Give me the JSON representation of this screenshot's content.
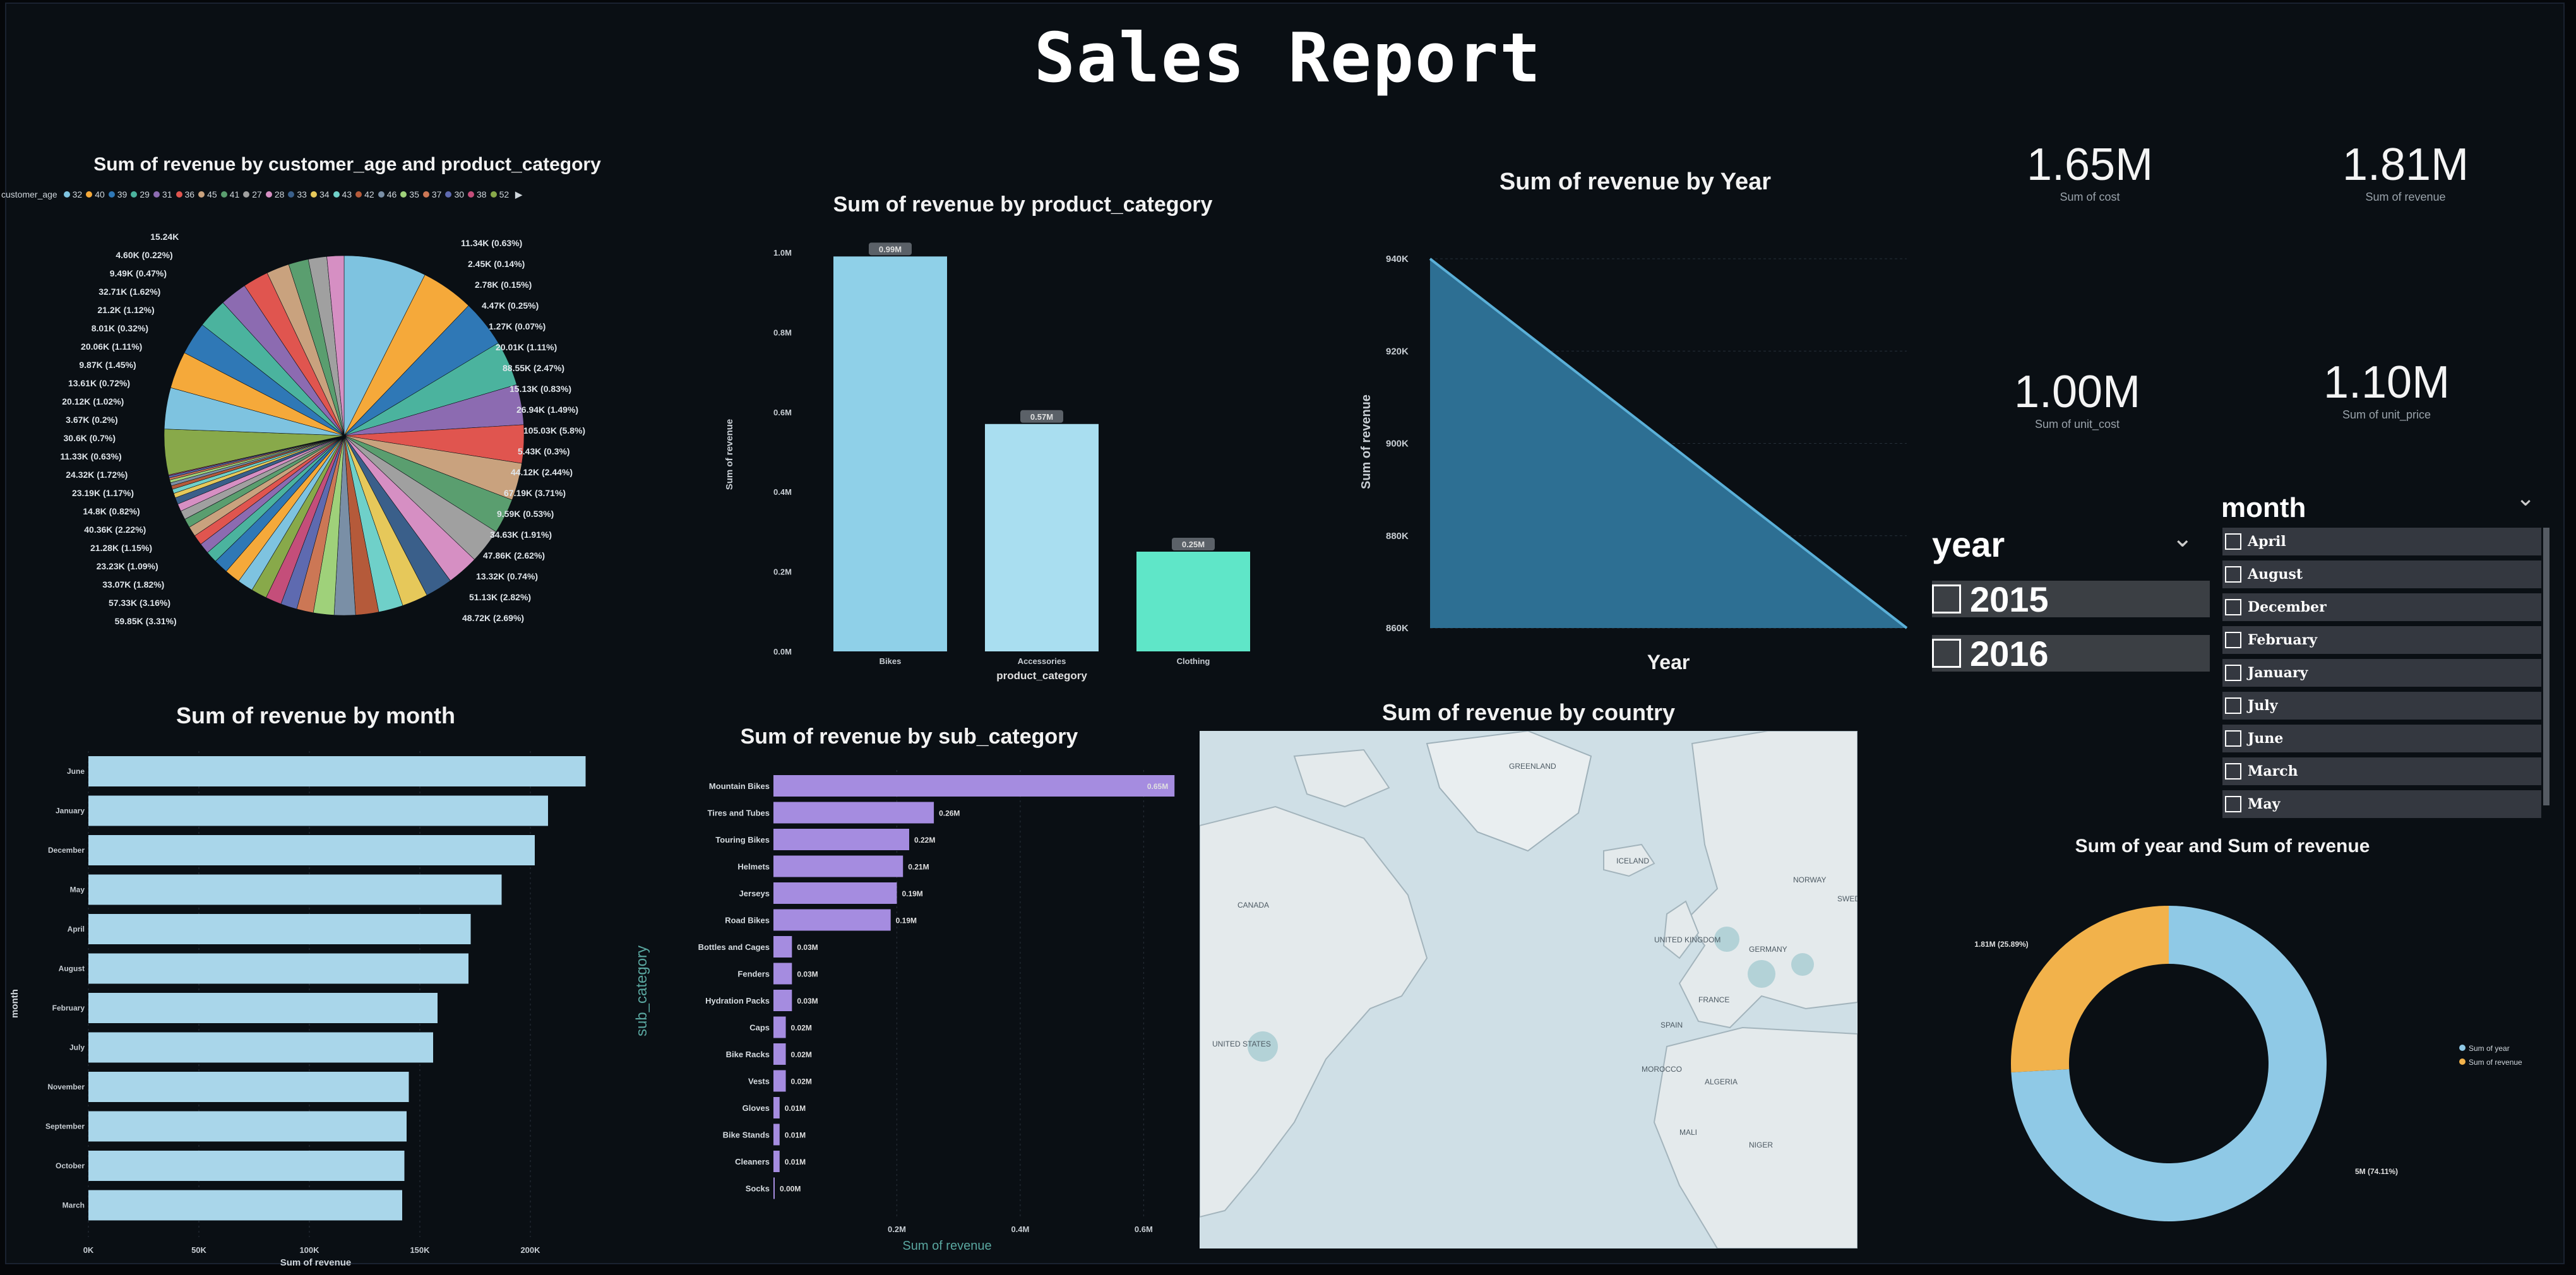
{
  "report_title": "Sales Report",
  "cards": [
    {
      "value": "1.65M",
      "label": "Sum of cost"
    },
    {
      "value": "1.81M",
      "label": "Sum of revenue"
    },
    {
      "value": "1.00M",
      "label": "Sum of unit_cost"
    },
    {
      "value": "1.10M",
      "label": "Sum of unit_price"
    }
  ],
  "year_slicer": {
    "title": "year",
    "items": [
      "2015",
      "2016"
    ]
  },
  "month_slicer": {
    "title": "month",
    "items": [
      "April",
      "August",
      "December",
      "February",
      "January",
      "July",
      "June",
      "March",
      "May"
    ]
  },
  "pie": {
    "title": "Sum of revenue by customer_age and product_category",
    "legend_label": "customer_age",
    "legend_items": [
      "32",
      "40",
      "39",
      "29",
      "31",
      "36",
      "45",
      "41",
      "27",
      "28",
      "33",
      "34",
      "43",
      "42",
      "46",
      "35",
      "37",
      "30",
      "38",
      "52"
    ],
    "labels_left": [
      "15.24K",
      "4.60K (0.22%)",
      "9.49K (0.47%)",
      "32.71K (1.62%)",
      "21.2K (1.12%)",
      "8.01K (0.32%)",
      "20.06K (1.11%)",
      "9.87K (1.45%)",
      "13.61K (0.72%)",
      "20.12K (1.02%)",
      "3.67K (0.2%)",
      "30.6K (0.7%)",
      "11.33K (0.63%)",
      "24.32K (1.72%)",
      "23.19K (1.17%)",
      "14.8K (0.82%)",
      "40.36K (2.22%)",
      "21.28K (1.15%)",
      "23.23K (1.09%)",
      "33.07K (1.82%)",
      "57.33K (3.16%)",
      "59.85K (3.31%)"
    ],
    "labels_right": [
      "11.34K (0.63%)",
      "2.45K (0.14%)",
      "2.78K (0.15%)",
      "4.47K (0.25%)",
      "1.27K (0.07%)",
      "20.01K (1.11%)",
      "88.55K (2.47%)",
      "15.13K (0.83%)",
      "26.94K (1.49%)",
      "105.03K (5.8%)",
      "5.43K (0.3%)",
      "44.12K (2.44%)",
      "67.19K (3.71%)",
      "9.59K (0.53%)",
      "34.63K (1.91%)",
      "47.86K (2.62%)",
      "13.32K (0.74%)",
      "51.13K (2.82%)",
      "48.72K (2.69%)"
    ],
    "colors": [
      "#7ec3e0",
      "#f5a93a",
      "#2f78b6",
      "#4bb39e",
      "#8c6bb1",
      "#e0554f",
      "#c9a27e",
      "#5a9e6f",
      "#a0a0a0",
      "#d68fc3",
      "#3a5f8a",
      "#e6c85a",
      "#6fd0c9",
      "#b55a3a",
      "#7a8fa6",
      "#9fd17a",
      "#cc7755",
      "#5e6ab0",
      "#c44e7a",
      "#88a94a"
    ],
    "values": [
      5.8,
      3.71,
      3.31,
      3.16,
      2.82,
      2.69,
      2.62,
      2.47,
      2.44,
      2.22,
      1.91,
      1.82,
      1.72,
      1.62,
      1.49,
      1.45,
      1.17,
      1.15,
      1.12,
      1.11,
      1.11,
      1.09,
      1.02,
      0.82,
      0.74,
      0.72,
      0.7,
      0.63,
      0.63,
      0.53,
      0.47,
      0.32,
      0.3,
      0.25,
      0.22,
      0.2,
      0.15,
      0.14,
      0.07,
      3.2,
      2.9,
      2.6,
      2.3,
      2.1,
      1.9,
      1.8,
      1.6,
      1.4,
      1.3,
      1.2
    ]
  },
  "chart_data": [
    {
      "type": "bar",
      "title": "Sum of revenue by product_category",
      "xlabel": "product_category",
      "ylabel": "Sum of revenue",
      "categories": [
        "Bikes",
        "Accessories",
        "Clothing"
      ],
      "values": [
        0.99,
        0.57,
        0.25
      ],
      "data_labels": [
        "0.99M",
        "0.57M",
        "0.25M"
      ],
      "yticks": [
        "0.0M",
        "0.2M",
        "0.4M",
        "0.6M",
        "0.8M",
        "1.0M"
      ],
      "ylim": [
        0,
        1.0
      ],
      "colors": [
        "#8fd0e8",
        "#a9def0",
        "#5fe6c8"
      ]
    },
    {
      "type": "area",
      "title": "Sum of revenue by Year",
      "xlabel": "Year",
      "ylabel": "Sum of revenue",
      "x": [
        "2015",
        "2016"
      ],
      "values": [
        940,
        860
      ],
      "yticks": [
        "860K",
        "880K",
        "900K",
        "920K",
        "940K"
      ],
      "ylim": [
        860,
        940
      ]
    },
    {
      "type": "bar",
      "orientation": "horizontal",
      "title": "Sum of revenue by month",
      "xlabel": "Sum of revenue",
      "ylabel": "month",
      "categories": [
        "June",
        "January",
        "December",
        "May",
        "April",
        "August",
        "February",
        "July",
        "November",
        "September",
        "October",
        "March"
      ],
      "values": [
        225,
        208,
        202,
        187,
        173,
        172,
        158,
        156,
        145,
        144,
        143,
        142
      ],
      "xticks": [
        "0K",
        "50K",
        "100K",
        "150K",
        "200K"
      ],
      "xlim": [
        0,
        230
      ]
    },
    {
      "type": "bar",
      "orientation": "horizontal",
      "title": "Sum of revenue by sub_category",
      "xlabel": "Sum of revenue",
      "ylabel": "sub_category",
      "categories": [
        "Mountain Bikes",
        "Tires and Tubes",
        "Touring Bikes",
        "Helmets",
        "Jerseys",
        "Road Bikes",
        "Bottles and Cages",
        "Fenders",
        "Hydration Packs",
        "Caps",
        "Bike Racks",
        "Vests",
        "Gloves",
        "Bike Stands",
        "Cleaners",
        "Socks"
      ],
      "values": [
        0.65,
        0.26,
        0.22,
        0.21,
        0.2,
        0.19,
        0.03,
        0.03,
        0.03,
        0.02,
        0.02,
        0.02,
        0.01,
        0.01,
        0.01,
        0.0
      ],
      "data_labels": [
        "0.65M",
        "0.26M",
        "0.22M",
        "0.21M",
        "0.19M",
        "0.19M",
        "0.03M",
        "0.03M",
        "0.03M",
        "0.02M",
        "0.02M",
        "0.02M",
        "0.01M",
        "0.01M",
        "0.01M",
        "0.00M"
      ],
      "xticks": [
        "0.2M",
        "0.4M",
        "0.6M"
      ],
      "xlim": [
        0,
        0.66
      ]
    },
    {
      "type": "pie",
      "subtype": "donut",
      "title": "Sum of year and Sum of revenue",
      "categories": [
        "Sum of year",
        "Sum of revenue"
      ],
      "values": [
        74.11,
        25.89
      ],
      "data_labels": [
        "5M (74.11%)",
        "1.81M (25.89%)"
      ],
      "colors": [
        "#8fc9e6",
        "#f2b24b"
      ]
    }
  ],
  "map": {
    "title": "Sum of revenue by country",
    "place_labels": [
      "GREENLAND",
      "CANADA",
      "UNITED STATES",
      "ICELAND",
      "NORWAY",
      "SWEDEN",
      "UNITED KINGDOM",
      "FRANCE",
      "GERMANY",
      "SPAIN",
      "MOROCCO",
      "ALGERIA",
      "MALI",
      "NIGER"
    ]
  }
}
